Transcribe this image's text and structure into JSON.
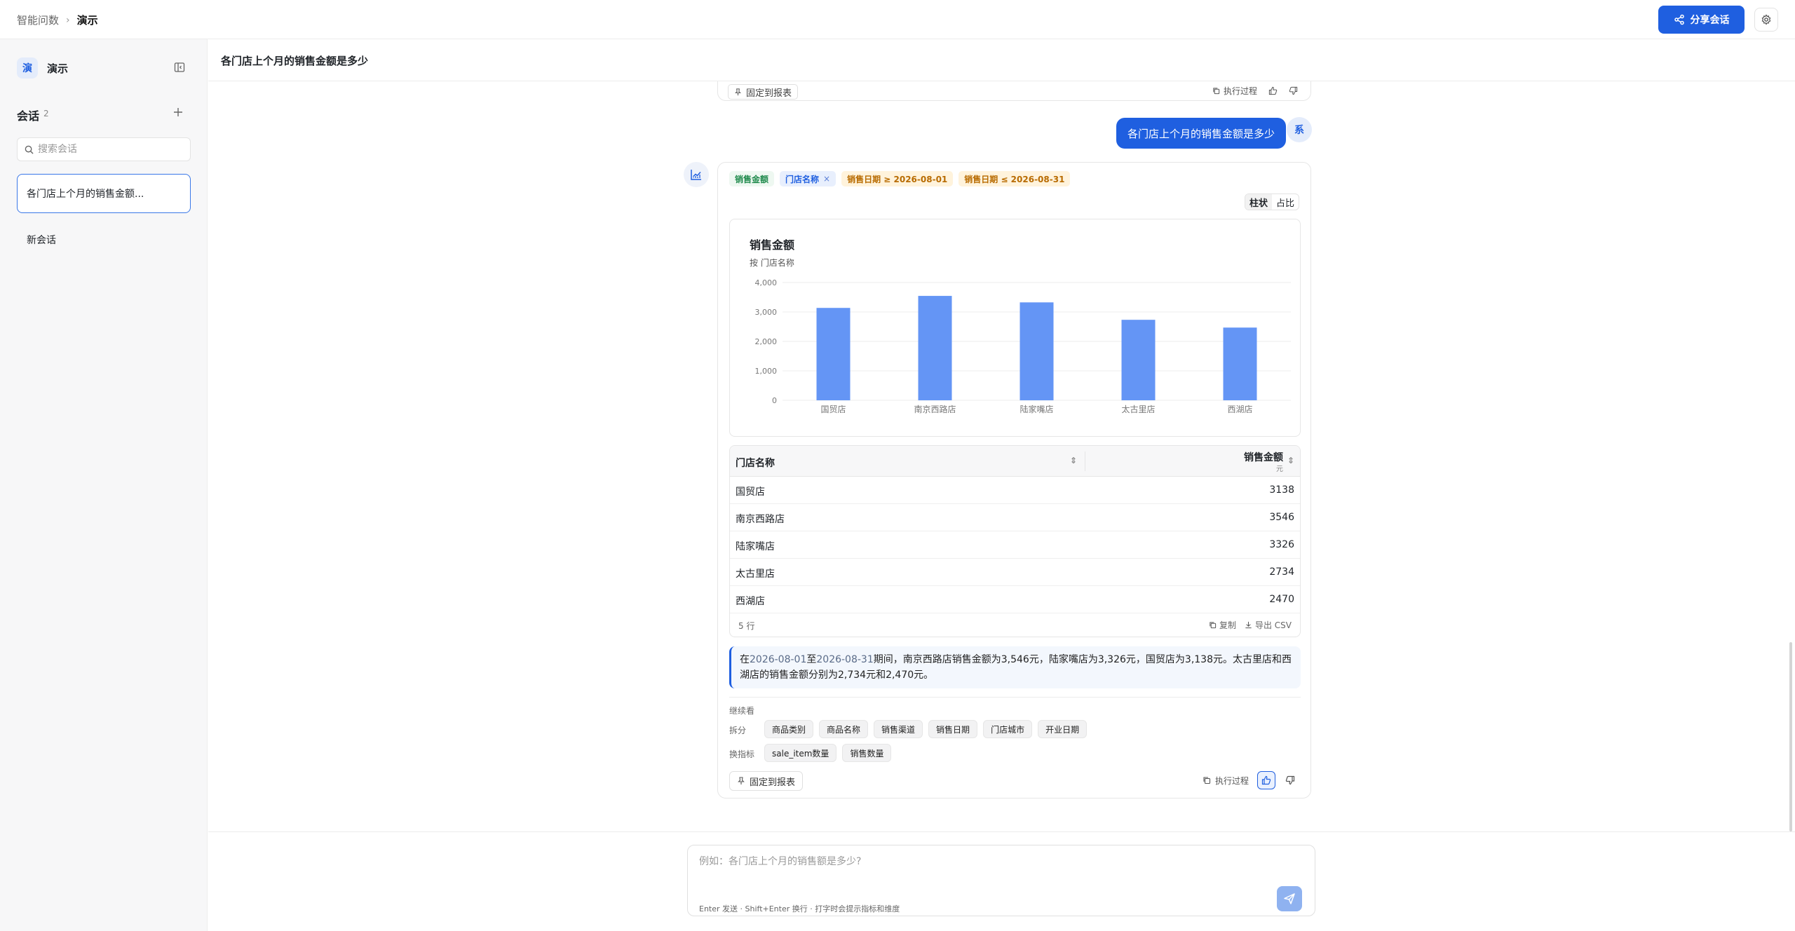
{
  "breadcrumb": {
    "root": "智能问数",
    "separator": "›",
    "current": "演示"
  },
  "header": {
    "share_label": "分享会话"
  },
  "sidebar": {
    "workspace_badge": "演",
    "workspace_name": "演示",
    "sessions_title": "会话",
    "sessions_count": "2",
    "search_placeholder": "搜索会话",
    "sessions": [
      {
        "label": "各门店上个月的销售金额...",
        "active": true
      },
      {
        "label": "新会话",
        "active": false
      }
    ]
  },
  "main": {
    "title": "各门店上个月的销售金额是多少"
  },
  "previous_card": {
    "pin_label": "固定到报表",
    "trace_label": "执行过程"
  },
  "user_message": {
    "text": "各门店上个月的销售金额是多少",
    "avatar": "系"
  },
  "answer": {
    "tags": {
      "metric": "销售金额",
      "dimension": "门店名称",
      "dimension_remove": "×",
      "filter_start": "销售日期 ≥ 2026-08-01",
      "filter_end": "销售日期 ≤ 2026-08-31"
    },
    "view_options": [
      "柱状",
      "占比"
    ],
    "chart_title": "销售金额",
    "chart_subtitle": "按 门店名称",
    "table": {
      "col1": "门店名称",
      "col2": "销售金额",
      "col2_unit": "元",
      "sort_glyph": "⇕",
      "rows": [
        {
          "name": "国贸店",
          "value": "3138"
        },
        {
          "name": "南京西路店",
          "value": "3546"
        },
        {
          "name": "陆家嘴店",
          "value": "3326"
        },
        {
          "name": "太古里店",
          "value": "2734"
        },
        {
          "name": "西湖店",
          "value": "2470"
        }
      ],
      "row_count": "5 行",
      "copy_label": "复制",
      "export_label": "导出 CSV"
    },
    "summary": {
      "p1": "在",
      "start_date": "2026-08-01",
      "p2": "至",
      "end_date": "2026-08-31",
      "p3": "期间，南京西路店销售金额为3,546元，陆家嘴店为3,326元，国贸店为3,138元。太古里店和西湖店的销售金额分别为2,734元和2,470元。"
    },
    "continue_label": "继续看",
    "breakdown_label": "拆分",
    "breakdown_chips": [
      "商品类别",
      "商品名称",
      "销售渠道",
      "销售日期",
      "门店城市",
      "开业日期"
    ],
    "switch_label": "换指标",
    "switch_chips": [
      "sale_item数量",
      "销售数量"
    ],
    "pin_label": "固定到报表",
    "trace_label": "执行过程"
  },
  "composer": {
    "placeholder": "例如：各门店上个月的销售额是多少?",
    "hint": "Enter 发送 · Shift+Enter 换行 · 打字时会提示指标和维度"
  },
  "colors": {
    "accent": "#1f5fe0",
    "bar": "#6495f5"
  },
  "chart_data": {
    "type": "bar",
    "title": "销售金额",
    "subtitle": "按 门店名称",
    "categories": [
      "国贸店",
      "南京西路店",
      "陆家嘴店",
      "太古里店",
      "西湖店"
    ],
    "values": [
      3138,
      3546,
      3326,
      2734,
      2470
    ],
    "ylim": [
      0,
      4000
    ],
    "yticks": [
      0,
      1000,
      2000,
      3000,
      4000
    ],
    "ytick_labels": [
      "0",
      "1,000",
      "2,000",
      "3,000",
      "4,000"
    ],
    "grid": true,
    "legend": "none"
  }
}
